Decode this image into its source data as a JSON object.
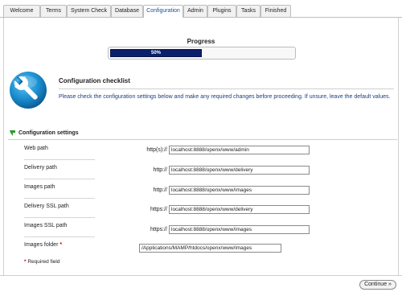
{
  "tabs": [
    {
      "label": "Welcome",
      "active": false
    },
    {
      "label": "Terms",
      "active": false
    },
    {
      "label": "System Check",
      "active": false
    },
    {
      "label": "Database",
      "active": false
    },
    {
      "label": "Configuration",
      "active": true
    },
    {
      "label": "Admin",
      "active": false
    },
    {
      "label": "Plugins",
      "active": false
    },
    {
      "label": "Tasks",
      "active": false
    },
    {
      "label": "Finished",
      "active": false
    }
  ],
  "progress": {
    "title": "Progress",
    "value": 0.5,
    "text": "50%"
  },
  "checklist": {
    "icon": "wrench-icon",
    "title": "Configuration checklist",
    "description": "Please check the configuration settings below and make any required changes before proceeding. If unsure, leave the default values."
  },
  "settings": {
    "icon": "green-arrow-icon",
    "title": "Configuration settings",
    "fields": [
      {
        "label": "Web path",
        "prefix": "http(s)://",
        "value": "localhost:8888/openx/www/admin",
        "required": false
      },
      {
        "label": "Delivery path",
        "prefix": "http://",
        "value": "localhost:8888/openx/www/delivery",
        "required": false
      },
      {
        "label": "Images path",
        "prefix": "http://",
        "value": "localhost:8888/openx/www/images",
        "required": false
      },
      {
        "label": "Delivery SSL path",
        "prefix": "https://",
        "value": "localhost:8888/openx/www/delivery",
        "required": false
      },
      {
        "label": "Images SSL path",
        "prefix": "https://",
        "value": "localhost:8888/openx/www/images",
        "required": false
      },
      {
        "label": "Images folder",
        "prefix": "",
        "value": "/Applications/MAMP/htdocs/openx/www/images",
        "required": true
      }
    ],
    "required_star": "*",
    "required_note": "Required field"
  },
  "continue_button": {
    "label": "Continue »"
  },
  "colors": {
    "progress_fill": "#0c1f6b",
    "link_text": "#1a3d7a",
    "required_star": "#d40000",
    "active_tab_text": "#1a4f9c",
    "wrench_circle": "#1b8fd0"
  }
}
